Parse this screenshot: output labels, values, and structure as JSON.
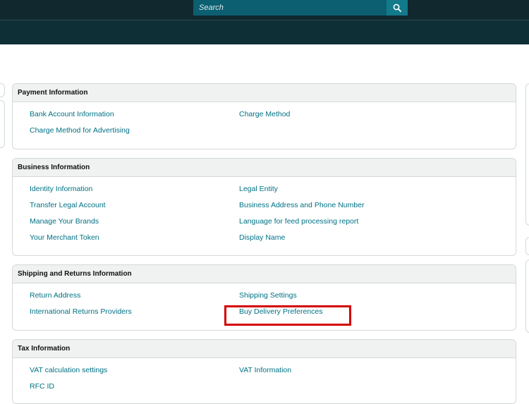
{
  "search": {
    "placeholder": "Search"
  },
  "sections": [
    {
      "title": "Payment Information",
      "links": [
        "Bank Account Information",
        "Charge Method",
        "Charge Method for Advertising"
      ]
    },
    {
      "title": "Business Information",
      "links": [
        "Identity Information",
        "Legal Entity",
        "Transfer Legal Account",
        "Business Address and Phone Number",
        "Manage Your Brands",
        "Language for feed processing report",
        "Your Merchant Token",
        "Display Name"
      ]
    },
    {
      "title": "Shipping and Returns Information",
      "links": [
        "Return Address",
        "Shipping Settings",
        "International Returns Providers",
        "Buy Delivery Preferences"
      ]
    },
    {
      "title": "Tax Information",
      "links": [
        "VAT calculation settings",
        "VAT Information",
        "RFC ID"
      ]
    }
  ],
  "colors": {
    "link": "#007185",
    "highlight": "#d40000",
    "header_bg": "#10282e"
  },
  "icons": {
    "search_button": "search-icon"
  }
}
